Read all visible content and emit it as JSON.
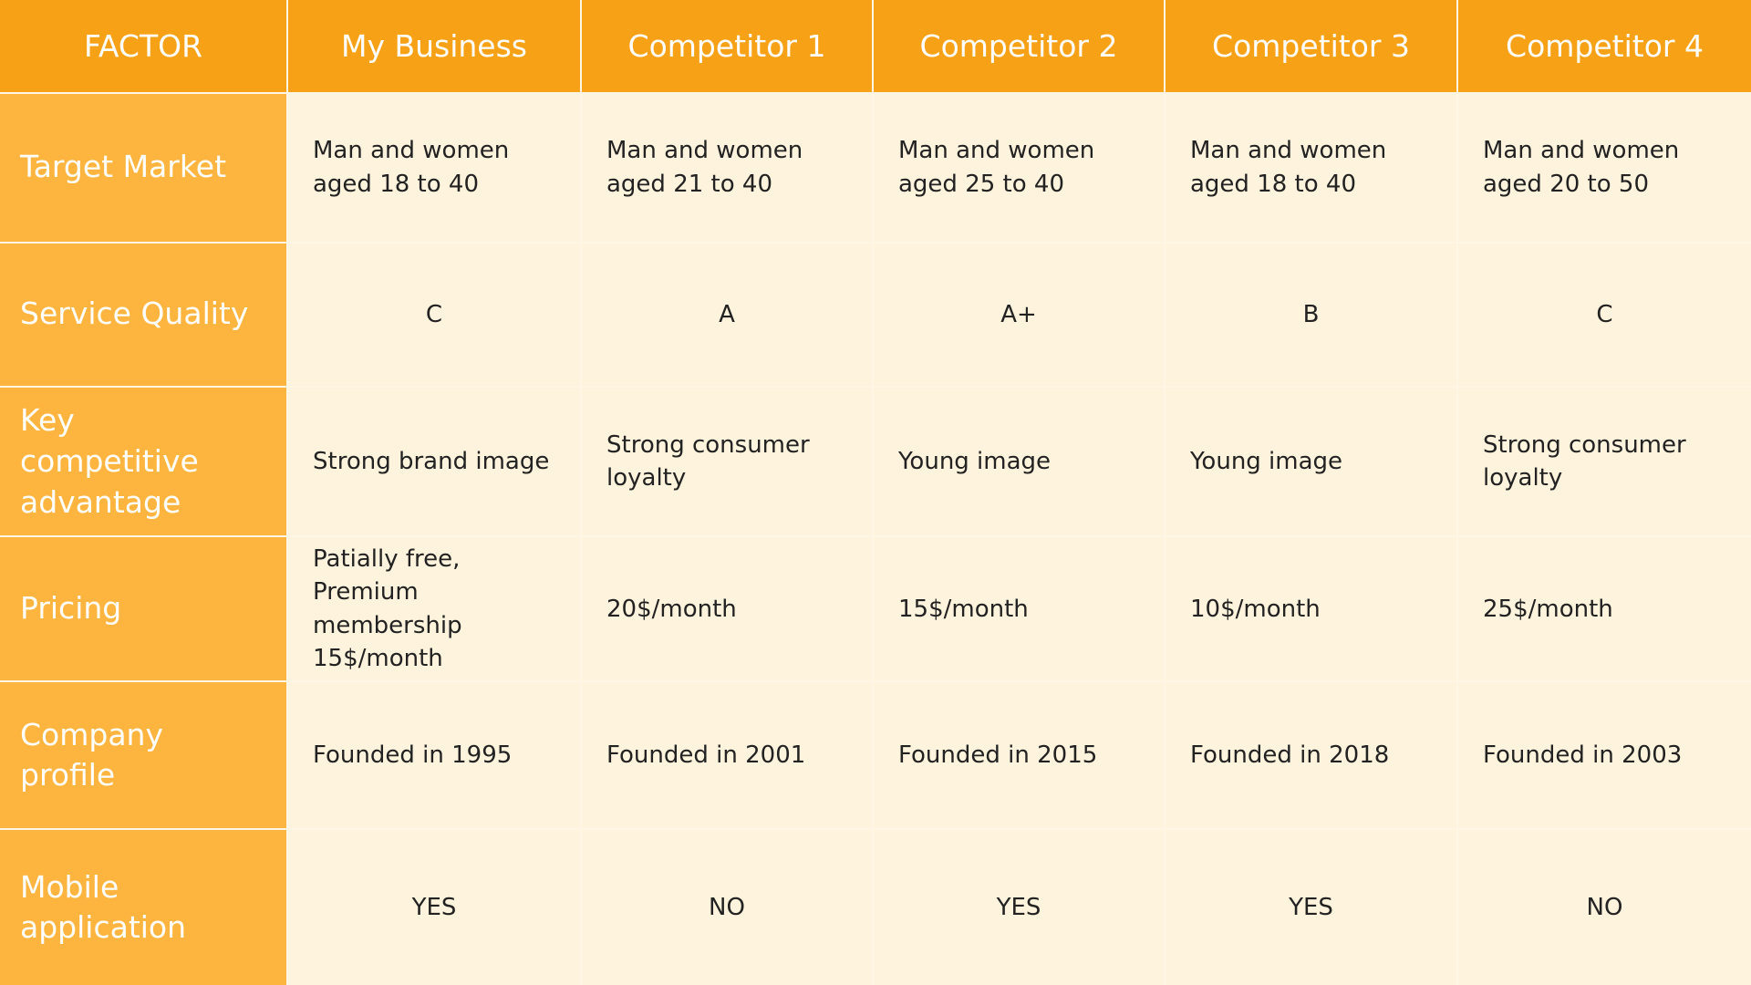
{
  "colors": {
    "header": "#f7a116",
    "factor_column": "#fdb53f",
    "cell": "#fef3dc"
  },
  "headers": [
    "FACTOR",
    "My Business",
    "Competitor 1",
    "Competitor 2",
    "Competitor 3",
    "Competitor 4"
  ],
  "rows": [
    {
      "factor": "Target Market",
      "align": "left",
      "values": [
        "Man and women aged 18 to 40",
        "Man and women aged 21 to 40",
        "Man and women aged 25 to 40",
        "Man and women aged 18 to 40",
        "Man and women aged 20 to 50"
      ]
    },
    {
      "factor": "Service Quality",
      "align": "center",
      "values": [
        "C",
        "A",
        "A+",
        "B",
        "C"
      ]
    },
    {
      "factor": "Key competitive advantage",
      "align": "left",
      "values": [
        "Strong brand image",
        "Strong consumer loyalty",
        "Young image",
        "Young image",
        "Strong consumer loyalty"
      ]
    },
    {
      "factor": "Pricing",
      "align": "left",
      "values": [
        "Patially free, Premium membership 15$/month",
        "20$/month",
        "15$/month",
        "10$/month",
        "25$/month"
      ]
    },
    {
      "factor": "Company profile",
      "align": "left",
      "values": [
        "Founded in 1995",
        "Founded in 2001",
        "Founded in 2015",
        "Founded in 2018",
        "Founded in 2003"
      ]
    },
    {
      "factor": "Mobile application",
      "align": "center",
      "values": [
        "YES",
        "NO",
        "YES",
        "YES",
        "NO"
      ]
    }
  ]
}
